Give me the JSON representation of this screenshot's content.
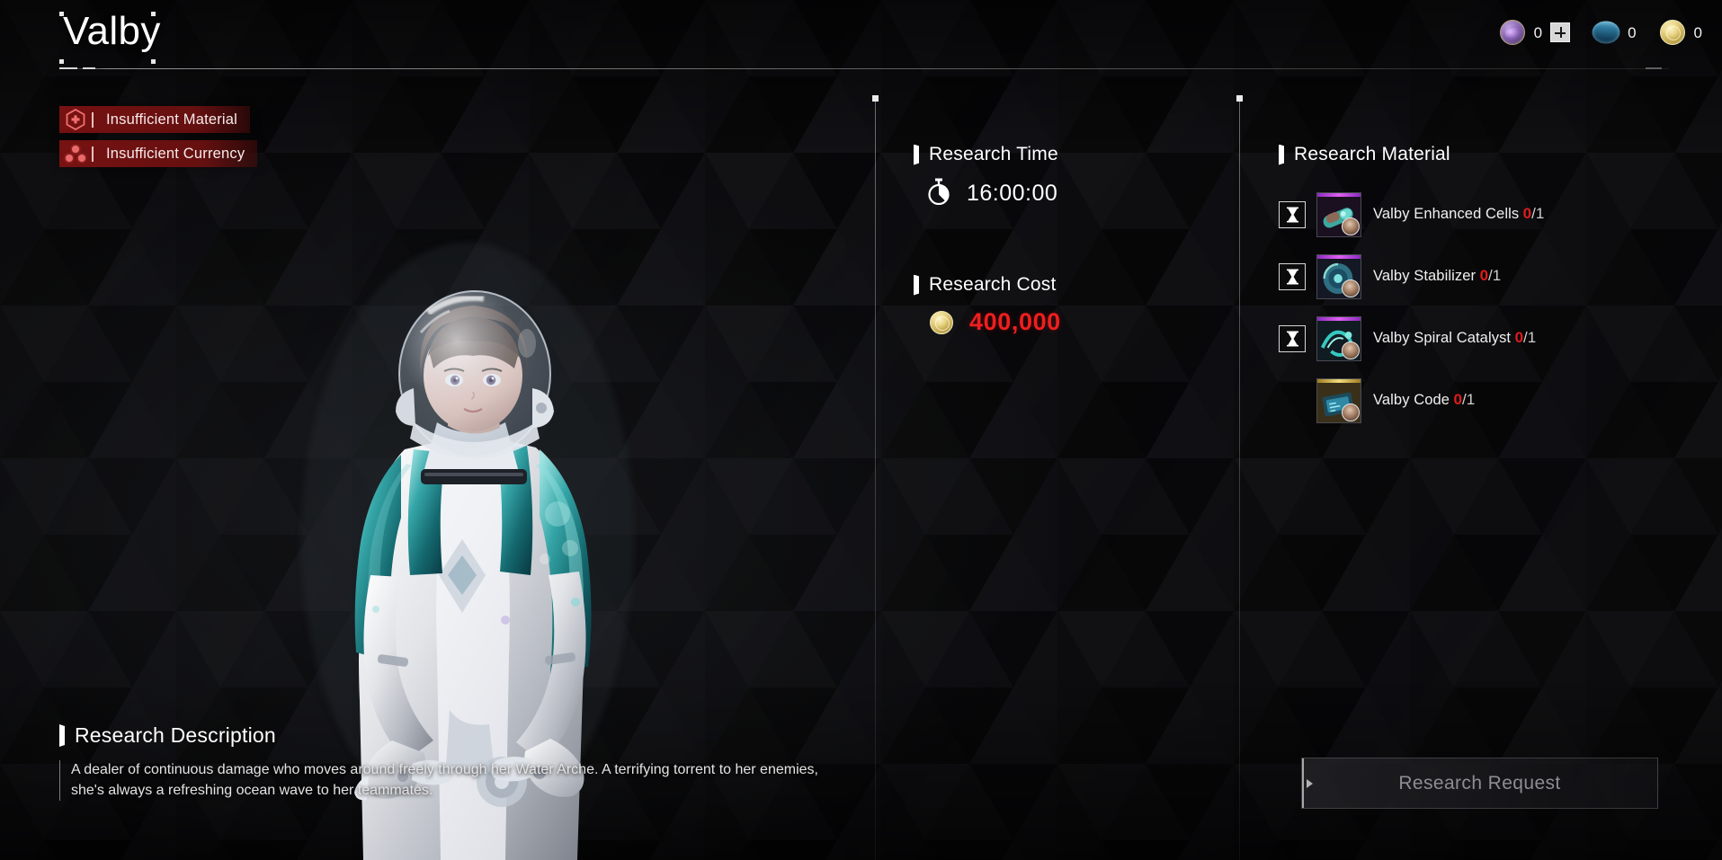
{
  "header": {
    "title": "Valby",
    "currencies": [
      {
        "icon": "kuiper-shard-icon",
        "name": "Kuiper Shard",
        "value": "0",
        "has_plus": true,
        "plus_label": "+"
      },
      {
        "icon": "caliber-icon",
        "name": "Caliber",
        "value": "0",
        "has_plus": false
      },
      {
        "icon": "gold-icon",
        "name": "Gold",
        "value": "0",
        "has_plus": false
      }
    ]
  },
  "warnings": [
    {
      "icon": "hex-plus-icon",
      "label": "Insufficient Material"
    },
    {
      "icon": "three-dots-icon",
      "label": "Insufficient Currency"
    }
  ],
  "research_time": {
    "heading": "Research Time",
    "icon": "stopwatch-icon",
    "value": "16:00:00"
  },
  "research_cost": {
    "heading": "Research Cost",
    "icon": "gold-coin-icon",
    "value": "400,000"
  },
  "research_material": {
    "heading": "Research Material",
    "items": [
      {
        "name": "Valby Enhanced Cells",
        "have": "0",
        "need": "/1",
        "rarity_color": "#c44de0",
        "has_timer": true,
        "timer_icon": "hourglass-icon"
      },
      {
        "name": "Valby Stabilizer",
        "have": "0",
        "need": "/1",
        "rarity_color": "#c44de0",
        "has_timer": true,
        "timer_icon": "hourglass-icon"
      },
      {
        "name": "Valby Spiral Catalyst",
        "have": "0",
        "need": "/1",
        "rarity_color": "#c44de0",
        "has_timer": true,
        "timer_icon": "hourglass-icon"
      },
      {
        "name": "Valby Code",
        "have": "0",
        "need": "/1",
        "rarity_color": "#d8b23c",
        "has_timer": false,
        "timer_icon": ""
      }
    ]
  },
  "research_description": {
    "heading": "Research Description",
    "body": "A dealer of continuous damage who moves around freely through her Water Arche. A terrifying torrent to her enemies, she's always a refreshing ocean wave to her teammates."
  },
  "action": {
    "request_label": "Research Request",
    "enabled": false
  },
  "colors": {
    "warning_red": "#7c1212",
    "cost_red": "#ee1f1f",
    "count_red": "#e01c1c",
    "gold": "#e8d484",
    "disabled_text": "#8d8d92"
  }
}
